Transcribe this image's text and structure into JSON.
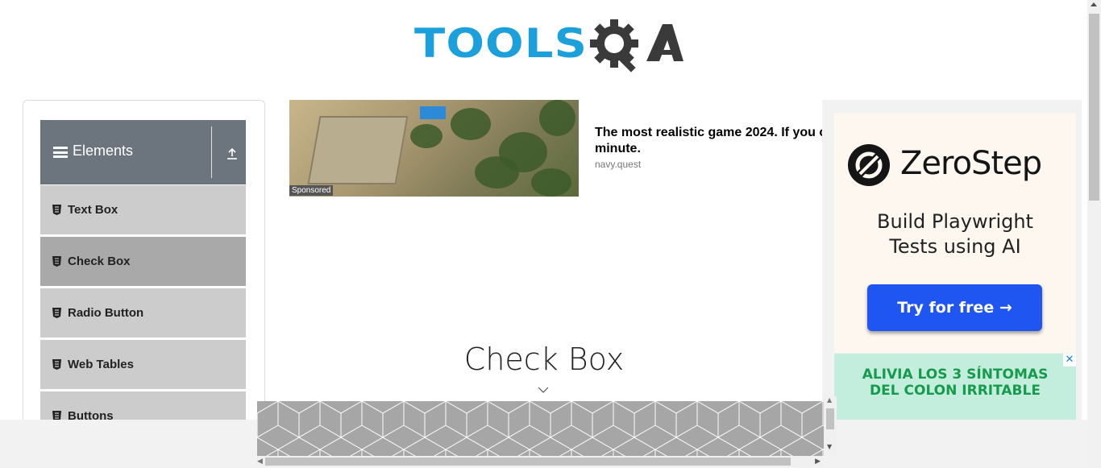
{
  "header": {
    "logo_text_tools": "TOOLS",
    "logo_text_qa": "QA",
    "logo_colors": {
      "tools": "#1ba0dc",
      "qa": "#3a3a3a"
    }
  },
  "sidebar": {
    "group_title": "Elements",
    "items": [
      {
        "label": "Text Box",
        "active": false
      },
      {
        "label": "Check Box",
        "active": true
      },
      {
        "label": "Radio Button",
        "active": false
      },
      {
        "label": "Web Tables",
        "active": false
      },
      {
        "label": "Buttons",
        "active": false
      }
    ]
  },
  "ad_top": {
    "sponsored": "Sponsored",
    "headline": "The most realistic game 2024. If you c minute.",
    "headline_line1": "The most realistic game 2024. If you c",
    "headline_line2": "minute.",
    "source": "navy.quest"
  },
  "ad_right": {
    "brand": "ZeroStep",
    "subtitle_line1": "Build Playwright",
    "subtitle_line2": "Tests using AI",
    "cta": "Try for free →",
    "cta_color": "#1f55f0",
    "secondary_line1": "ALIVIA LOS 3  SÍNTOMAS",
    "secondary_line2": "DEL COLON IRRITABLE",
    "adchoices_icon": "close-icon"
  },
  "main": {
    "page_title": "Check Box"
  }
}
